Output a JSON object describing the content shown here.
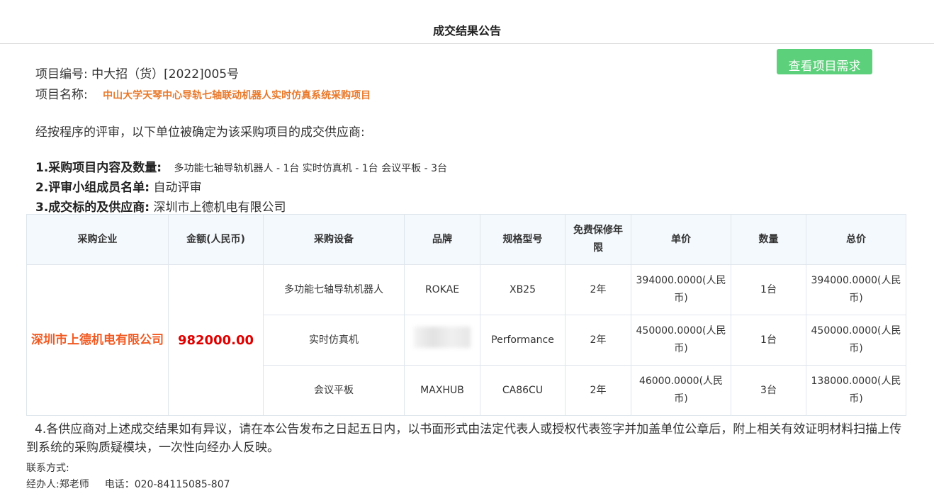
{
  "page": {
    "title": "成交结果公告",
    "view_requirements_button": "查看项目需求"
  },
  "project": {
    "number_label": "项目编号:",
    "number_value": "中大招（货）[2022]005号",
    "name_label": "项目名称:",
    "name_value": "中山大学天琴中心导轨七轴联动机器人实时仿真系统采购项目"
  },
  "intro": "经按程序的评审，以下单位被确定为该采购项目的成交供应商:",
  "items": {
    "content_label": "1.采购项目内容及数量:",
    "content_value": "多功能七轴导轨机器人 - 1台 实时仿真机 - 1台 会议平板 - 3台",
    "panel_label": "2.评审小组成员名单:",
    "panel_value": "自动评审",
    "supplier_label": "3.成交标的及供应商:",
    "supplier_value": "深圳市上德机电有限公司"
  },
  "table": {
    "headers": [
      "采购企业",
      "金额(人民币)",
      "采购设备",
      "品牌",
      "规格型号",
      "免费保修年限",
      "单价",
      "数量",
      "总价"
    ],
    "vendor": "深圳市上德机电有限公司",
    "amount": "982000.00",
    "rows": [
      {
        "device": "多功能七轴导轨机器人",
        "brand": "ROKAE",
        "model": "XB25",
        "warranty": "2年",
        "unit_price": "394000.0000(人民币)",
        "qty": "1台",
        "total": "394000.0000(人民币)"
      },
      {
        "device": "实时仿真机",
        "brand": "",
        "model": "Performance",
        "warranty": "2年",
        "unit_price": "450000.0000(人民币)",
        "qty": "1台",
        "total": "450000.0000(人民币)"
      },
      {
        "device": "会议平板",
        "brand": "MAXHUB",
        "model": "CA86CU",
        "warranty": "2年",
        "unit_price": "46000.0000(人民币)",
        "qty": "3台",
        "total": "138000.0000(人民币)"
      }
    ]
  },
  "notice": "4.各供应商对上述成交结果如有异议，请在本公告发布之日起五日内，以书面形式由法定代表人或授权代表签字并加盖单位公章后，附上相关有效证明材料扫描上传到系统的采购质疑模块，一次性向经办人反映。",
  "contact": {
    "heading": "联系方式:",
    "handler": "经办人:郑老师",
    "phone": "电话：020-84115085-807"
  }
}
